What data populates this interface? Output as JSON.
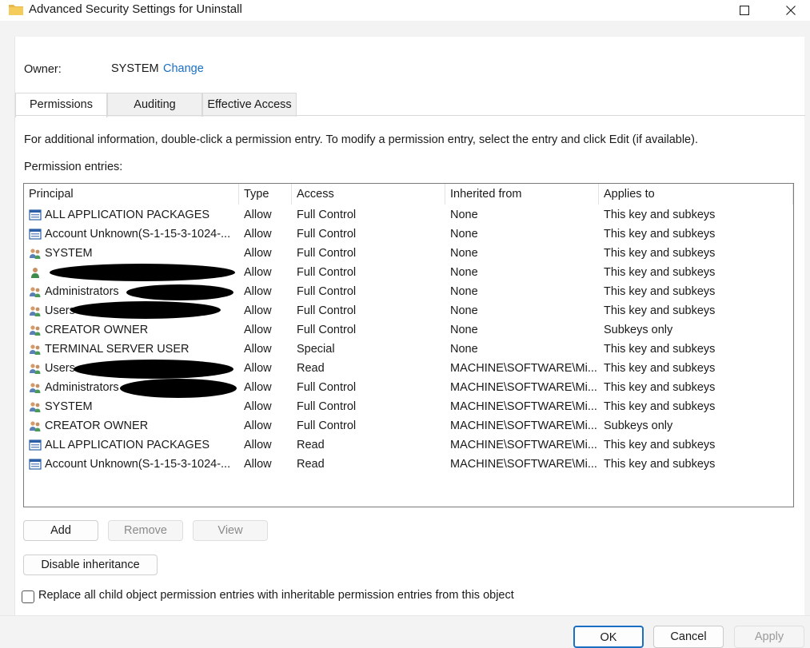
{
  "window": {
    "title": "Advanced Security Settings for Uninstall",
    "folder_icon": "folder-icon",
    "maximize_icon": "maximize-icon",
    "close_icon": "close-icon"
  },
  "owner": {
    "label": "Owner:",
    "value": "SYSTEM",
    "change_link": "Change"
  },
  "tabs": [
    {
      "label": "Permissions",
      "active": true
    },
    {
      "label": "Auditing",
      "active": false
    },
    {
      "label": "Effective Access",
      "active": false
    }
  ],
  "info_text": "For additional information, double-click a permission entry. To modify a permission entry, select the entry and click Edit (if available).",
  "entries_label": "Permission entries:",
  "columns": [
    "Principal",
    "Type",
    "Access",
    "Inherited from",
    "Applies to"
  ],
  "rows": [
    {
      "icon": "app-package-icon",
      "principal": "ALL APPLICATION PACKAGES",
      "type": "Allow",
      "access": "Full Control",
      "inherited": "None",
      "applies": "This key and subkeys"
    },
    {
      "icon": "app-package-icon",
      "principal": "Account Unknown(S-1-15-3-1024-...",
      "type": "Allow",
      "access": "Full Control",
      "inherited": "None",
      "applies": "This key and subkeys"
    },
    {
      "icon": "group-icon",
      "principal": "SYSTEM",
      "type": "Allow",
      "access": "Full Control",
      "inherited": "None",
      "applies": "This key and subkeys"
    },
    {
      "icon": "user-icon",
      "principal": "",
      "type": "Allow",
      "access": "Full Control",
      "inherited": "None",
      "applies": "This key and subkeys"
    },
    {
      "icon": "group-icon",
      "principal": "Administrators",
      "type": "Allow",
      "access": "Full Control",
      "inherited": "None",
      "applies": "This key and subkeys"
    },
    {
      "icon": "group-icon",
      "principal": "Users",
      "type": "Allow",
      "access": "Full Control",
      "inherited": "None",
      "applies": "This key and subkeys"
    },
    {
      "icon": "group-icon",
      "principal": "CREATOR OWNER",
      "type": "Allow",
      "access": "Full Control",
      "inherited": "None",
      "applies": "Subkeys only"
    },
    {
      "icon": "group-icon",
      "principal": "TERMINAL SERVER USER",
      "type": "Allow",
      "access": "Special",
      "inherited": "None",
      "applies": "This key and subkeys"
    },
    {
      "icon": "group-icon",
      "principal": "Users",
      "type": "Allow",
      "access": "Read",
      "inherited": "MACHINE\\SOFTWARE\\Mi...",
      "applies": "This key and subkeys"
    },
    {
      "icon": "group-icon",
      "principal": "Administrators",
      "type": "Allow",
      "access": "Full Control",
      "inherited": "MACHINE\\SOFTWARE\\Mi...",
      "applies": "This key and subkeys"
    },
    {
      "icon": "group-icon",
      "principal": "SYSTEM",
      "type": "Allow",
      "access": "Full Control",
      "inherited": "MACHINE\\SOFTWARE\\Mi...",
      "applies": "This key and subkeys"
    },
    {
      "icon": "group-icon",
      "principal": "CREATOR OWNER",
      "type": "Allow",
      "access": "Full Control",
      "inherited": "MACHINE\\SOFTWARE\\Mi...",
      "applies": "Subkeys only"
    },
    {
      "icon": "app-package-icon",
      "principal": "ALL APPLICATION PACKAGES",
      "type": "Allow",
      "access": "Read",
      "inherited": "MACHINE\\SOFTWARE\\Mi...",
      "applies": "This key and subkeys"
    },
    {
      "icon": "app-package-icon",
      "principal": "Account Unknown(S-1-15-3-1024-...",
      "type": "Allow",
      "access": "Read",
      "inherited": "MACHINE\\SOFTWARE\\Mi...",
      "applies": "This key and subkeys"
    }
  ],
  "buttons": {
    "add": "Add",
    "remove": "Remove",
    "view": "View",
    "disable_inheritance": "Disable inheritance"
  },
  "replace_checkbox": {
    "label": "Replace all child object permission entries with inheritable permission entries from this object",
    "checked": false
  },
  "footer": {
    "ok": "OK",
    "cancel": "Cancel",
    "apply": "Apply"
  },
  "colors": {
    "link": "#1a6fc4",
    "primary_border": "#1a6fc4"
  }
}
